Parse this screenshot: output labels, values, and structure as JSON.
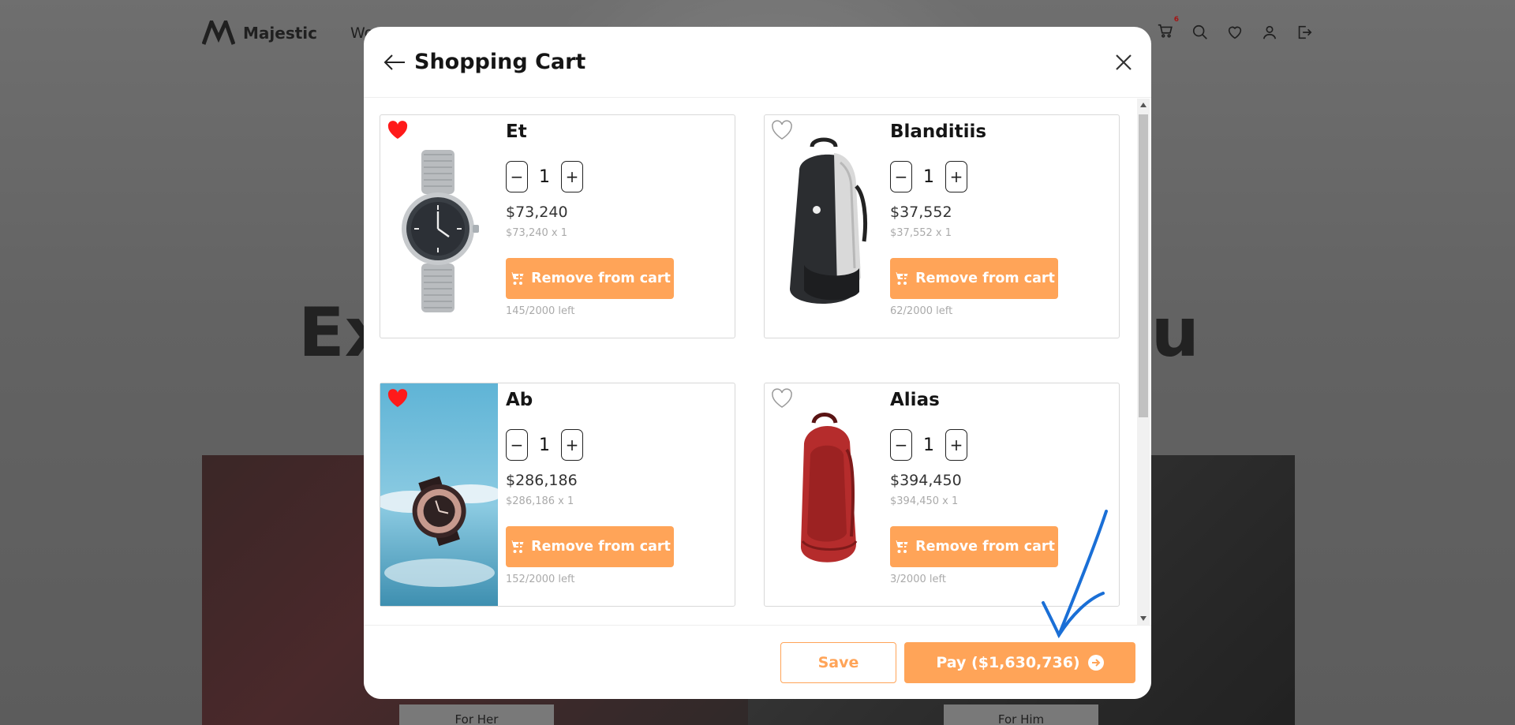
{
  "site": {
    "brand": "Majestic",
    "nav_first": "Wom",
    "cart_count": "6",
    "hero_left": "Ex",
    "hero_right": "ou",
    "banner_left_btn": "For Her",
    "banner_right_btn": "For Him"
  },
  "modal": {
    "title": "Shopping Cart",
    "save_label": "Save",
    "pay_label": "Pay ($1,630,736)"
  },
  "colors": {
    "accent": "#ffa458",
    "favorite": "#ff1a1a"
  },
  "cart": {
    "items": [
      {
        "name": "Et",
        "favorited": true,
        "image": "wristwatch-silver",
        "qty": "1",
        "price": "$73,240",
        "subtotal": "$73,240 x 1",
        "remove_label": "Remove from cart",
        "stock": "145/2000 left"
      },
      {
        "name": "Blanditiis",
        "favorited": false,
        "image": "backpack-black",
        "qty": "1",
        "price": "$37,552",
        "subtotal": "$37,552 x 1",
        "remove_label": "Remove from cart",
        "stock": "62/2000 left"
      },
      {
        "name": "Ab",
        "favorited": true,
        "image": "wristwatch-sky",
        "qty": "1",
        "price": "$286,186",
        "subtotal": "$286,186 x 1",
        "remove_label": "Remove from cart",
        "stock": "152/2000 left"
      },
      {
        "name": "Alias",
        "favorited": false,
        "image": "backpack-red",
        "qty": "1",
        "price": "$394,450",
        "subtotal": "$394,450 x 1",
        "remove_label": "Remove from cart",
        "stock": "3/2000 left"
      }
    ]
  }
}
